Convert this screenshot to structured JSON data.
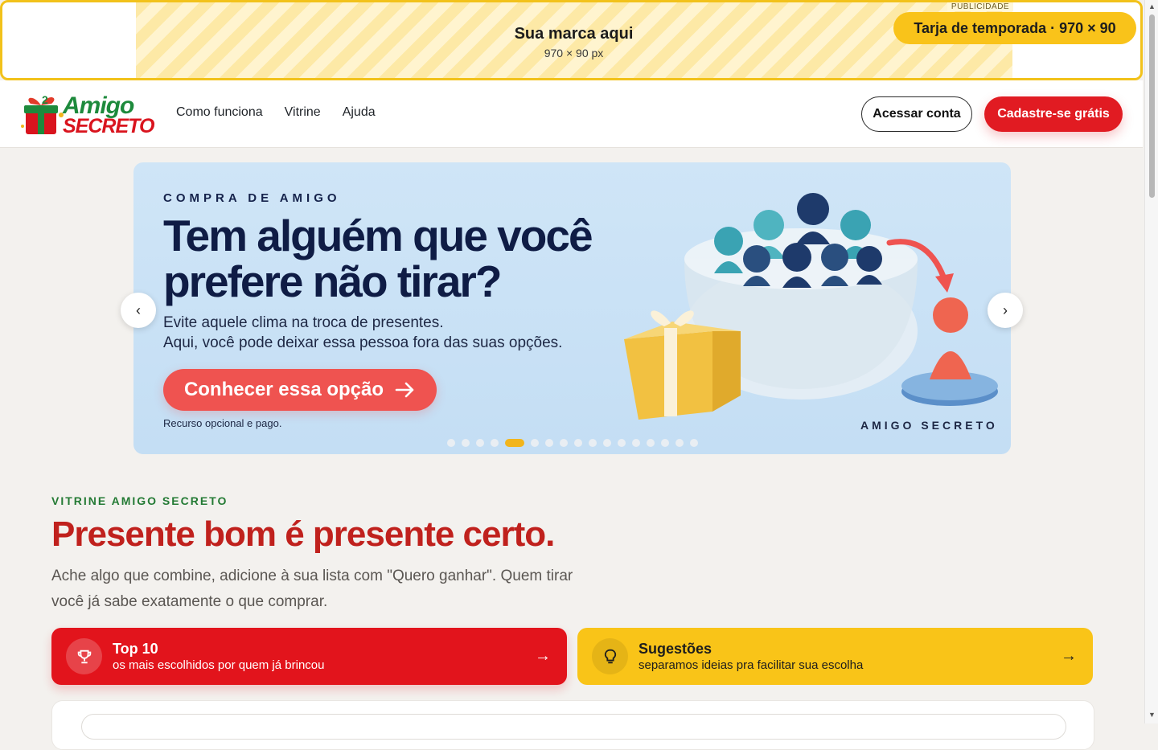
{
  "ad": {
    "title": "Sua marca aqui",
    "size": "970 × 90 px",
    "tag": "PUBLICIDADE",
    "pill": "Tarja de temporada · 970 × 90"
  },
  "header": {
    "logo_line1": "Amigo",
    "logo_line2": "SECRETO",
    "nav": [
      "Como funciona",
      "Vitrine",
      "Ajuda"
    ],
    "login": "Acessar conta",
    "signup": "Cadastre-se grátis"
  },
  "hero": {
    "eyebrow": "COMPRA DE AMIGO",
    "title": "Tem alguém que você prefere não tirar?",
    "desc_line1": "Evite aquele clima na troca de presentes.",
    "desc_line2": "Aqui, você pode deixar essa pessoa fora das suas opções.",
    "cta": "Conhecer essa opção",
    "note": "Recurso opcional e pago.",
    "brand": "AMIGO SECRETO",
    "slides_total": 17,
    "active_slide": 5,
    "prev_icon": "chevron-left-icon",
    "next_icon": "chevron-right-icon"
  },
  "showcase": {
    "eyebrow": "VITRINE AMIGO SECRETO",
    "title": "Presente bom é presente certo.",
    "desc": "Ache algo que combine, adicione à sua lista com \"Quero ganhar\". Quem tirar você já sabe exatamente o que comprar.",
    "cards": [
      {
        "title": "Top 10",
        "subtitle": "os mais escolhidos por quem já brincou",
        "icon": "trophy-icon",
        "color": "#e2141c"
      },
      {
        "title": "Sugestões",
        "subtitle": "separamos ideias pra facilitar sua escolha",
        "icon": "lightbulb-icon",
        "color": "#f9c418"
      }
    ]
  },
  "colors": {
    "brand_red": "#e11b22",
    "brand_green": "#1d8a3c",
    "accent_yellow": "#f9c418",
    "hero_bg": "#cfe5f7",
    "cta_coral": "#ef5350"
  }
}
